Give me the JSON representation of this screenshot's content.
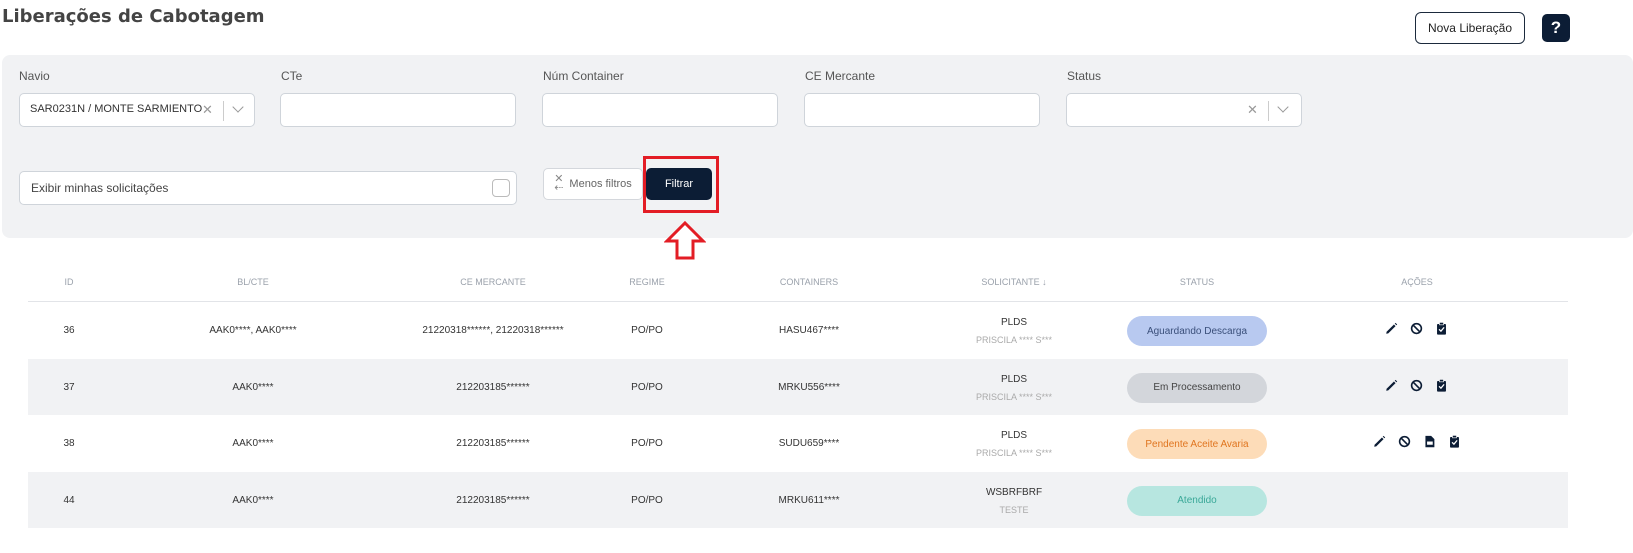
{
  "header": {
    "title": "Liberações de Cabotagem",
    "nova_label": "Nova Liberação",
    "help_label": "?"
  },
  "filters": {
    "navio": {
      "label": "Navio",
      "value": "SAR0231N / MONTE SARMIENTO"
    },
    "cte": {
      "label": "CTe",
      "value": ""
    },
    "num_container": {
      "label": "Núm Container",
      "value": ""
    },
    "ce_mercante": {
      "label": "CE Mercante",
      "value": ""
    },
    "status": {
      "label": "Status",
      "value": ""
    },
    "exibir_label": "Exibir minhas solicitações",
    "menos_filtros_label": "Menos filtros",
    "filtrar_label": "Filtrar"
  },
  "table": {
    "headers": {
      "id": "ID",
      "bl": "BL/CTE",
      "ce": "CE MERCANTE",
      "regime": "REGIME",
      "containers": "CONTAINERS",
      "solicitante": "SOLICITANTE",
      "sort_glyph": "↓",
      "status": "STATUS",
      "acoes": "AÇÕES"
    },
    "rows": [
      {
        "id": "36",
        "bl": "AAK0****, AAK0****",
        "ce": "21220318******, 21220318******",
        "regime": "PO/PO",
        "containers": "HASU467****",
        "sol_org": "PLDS",
        "sol_user": "PRISCILA **** S***",
        "status": "Aguardando Descarga"
      },
      {
        "id": "37",
        "bl": "AAK0****",
        "ce": "212203185******",
        "regime": "PO/PO",
        "containers": "MRKU556****",
        "sol_org": "PLDS",
        "sol_user": "PRISCILA **** S***",
        "status": "Em Processamento"
      },
      {
        "id": "38",
        "bl": "AAK0****",
        "ce": "212203185******",
        "regime": "PO/PO",
        "containers": "SUDU659****",
        "sol_org": "PLDS",
        "sol_user": "PRISCILA **** S***",
        "status": "Pendente Aceite Avaria"
      },
      {
        "id": "44",
        "bl": "AAK0****",
        "ce": "212203185******",
        "regime": "PO/PO",
        "containers": "MRKU611****",
        "sol_org": "WSBRFBRF",
        "sol_user": "TESTE",
        "status": "Atendido"
      }
    ]
  },
  "colors": {
    "primary": "#0c1d35",
    "highlight": "#e31d25",
    "status_aguardando": "#b8c9f0",
    "status_processamento": "#d3d6db",
    "status_pendente": "#fddcb8",
    "status_pendente_text": "#e0751f",
    "status_atendido": "#b7e6e0",
    "status_atendido_text": "#3aa898"
  },
  "icons": [
    "pencil-icon",
    "cancel-icon",
    "clipboard-check-icon",
    "pdf-file-icon",
    "help-icon",
    "close-icon",
    "chevron-down-icon"
  ]
}
